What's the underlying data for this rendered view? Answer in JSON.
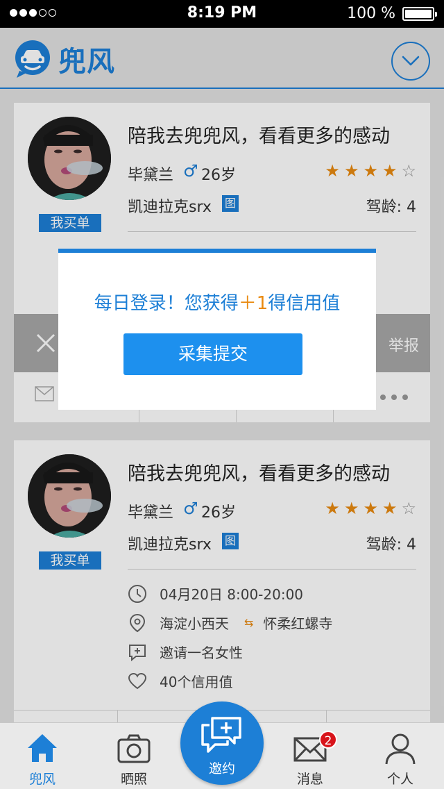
{
  "status_bar": {
    "time": "8:19 PM",
    "battery_text": "100 %"
  },
  "header": {
    "app_name": "兜风"
  },
  "cards": [
    {
      "title": "陪我去兜兜风，看看更多的感动",
      "name": "毕黛兰",
      "gender_symbol": "♂",
      "age": "26岁",
      "rating": 4,
      "rating_max": 5,
      "car": "凯迪拉克srx",
      "car_tag": "图",
      "driving_age": "驾龄: 4",
      "badge": "我买单",
      "report_label": "举报"
    },
    {
      "title": "陪我去兜兜风，看看更多的感动",
      "name": "毕黛兰",
      "gender_symbol": "♂",
      "age": "26岁",
      "rating": 4,
      "rating_max": 5,
      "car": "凯迪拉克srx",
      "car_tag": "图",
      "driving_age": "驾龄: 4",
      "badge": "我买单",
      "datetime": "04月20日  8:00-20:00",
      "from": "海淀小西天",
      "to": "怀柔红螺寺",
      "invite": "邀请一名女性",
      "credit": "40个信用值"
    }
  ],
  "modal": {
    "message_prefix": "每日登录！您获得",
    "message_plus": "＋1",
    "message_suffix": "得信用值",
    "button_label": "采集提交"
  },
  "tabbar": {
    "tabs": [
      {
        "label": "兜风",
        "icon": "home-icon",
        "active": true
      },
      {
        "label": "晒照",
        "icon": "camera-icon",
        "active": false
      },
      {
        "label": "邀约",
        "icon": "chat-plus-icon",
        "active": false
      },
      {
        "label": "消息",
        "icon": "mail-icon",
        "active": false,
        "badge": "2"
      },
      {
        "label": "个人",
        "icon": "person-icon",
        "active": false
      }
    ]
  },
  "colors": {
    "accent": "#1d7fd6",
    "star": "#e98a10",
    "badge_red": "#d8141b"
  }
}
